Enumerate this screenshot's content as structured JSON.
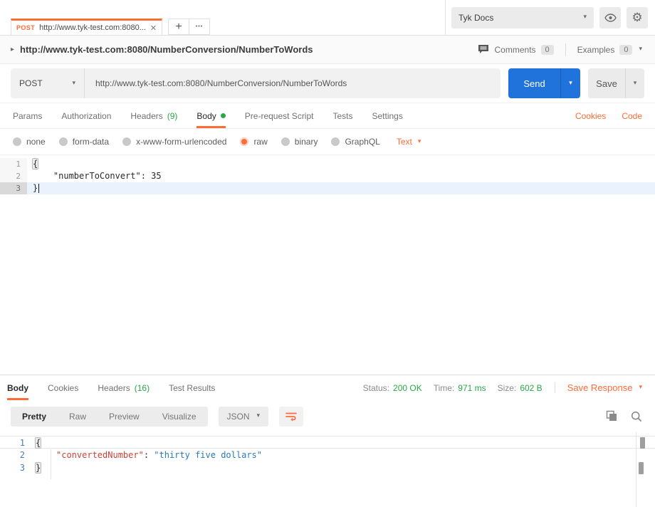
{
  "colors": {
    "accent_orange": "#ff6c37",
    "status_green": "#29a847",
    "send_blue": "#2173dc"
  },
  "icons": {
    "close": "✕",
    "plus": "+",
    "more": "•••",
    "caret": "▾",
    "disclosure": "▸",
    "gear": "⚙"
  },
  "header": {
    "tab_method": "POST",
    "tab_title": "http://www.tyk-test.com:8080...",
    "environment": "Tyk Docs"
  },
  "request": {
    "title": "http://www.tyk-test.com:8080/NumberConversion/NumberToWords",
    "comments_label": "Comments",
    "comments_count": "0",
    "examples_label": "Examples",
    "examples_count": "0",
    "method": "POST",
    "url": "http://www.tyk-test.com:8080/NumberConversion/NumberToWords",
    "send_label": "Send",
    "save_label": "Save",
    "tabs": [
      {
        "label": "Params",
        "count": ""
      },
      {
        "label": "Authorization",
        "count": ""
      },
      {
        "label": "Headers",
        "count": "(9)"
      },
      {
        "label": "Body",
        "count": ""
      },
      {
        "label": "Pre-request Script",
        "count": ""
      },
      {
        "label": "Tests",
        "count": ""
      },
      {
        "label": "Settings",
        "count": ""
      }
    ],
    "cookies_link": "Cookies",
    "code_link": "Code",
    "body_modes": [
      "none",
      "form-data",
      "x-www-form-urlencoded",
      "raw",
      "binary",
      "GraphQL"
    ],
    "selected_mode": "raw",
    "raw_type": "Text",
    "editor": {
      "line1": {
        "n": "1",
        "text": "{"
      },
      "line2": {
        "n": "2",
        "text": "    \"numberToConvert\": 35"
      },
      "line3": {
        "n": "3",
        "text": "}"
      }
    }
  },
  "response": {
    "tabs": [
      {
        "label": "Body",
        "count": ""
      },
      {
        "label": "Cookies",
        "count": ""
      },
      {
        "label": "Headers",
        "count": "(16)"
      },
      {
        "label": "Test Results",
        "count": ""
      }
    ],
    "status_label": "Status:",
    "status_value": "200 OK",
    "time_label": "Time:",
    "time_value": "971 ms",
    "size_label": "Size:",
    "size_value": "602 B",
    "save_response_label": "Save Response",
    "views": [
      "Pretty",
      "Raw",
      "Preview",
      "Visualize"
    ],
    "format": "JSON",
    "editor": {
      "line1": {
        "n": "1",
        "brace": "{"
      },
      "line2": {
        "n": "2",
        "key": "\"convertedNumber\"",
        "colon": ": ",
        "value": "\"thirty five dollars\""
      },
      "line3": {
        "n": "3",
        "brace": "}"
      }
    }
  }
}
